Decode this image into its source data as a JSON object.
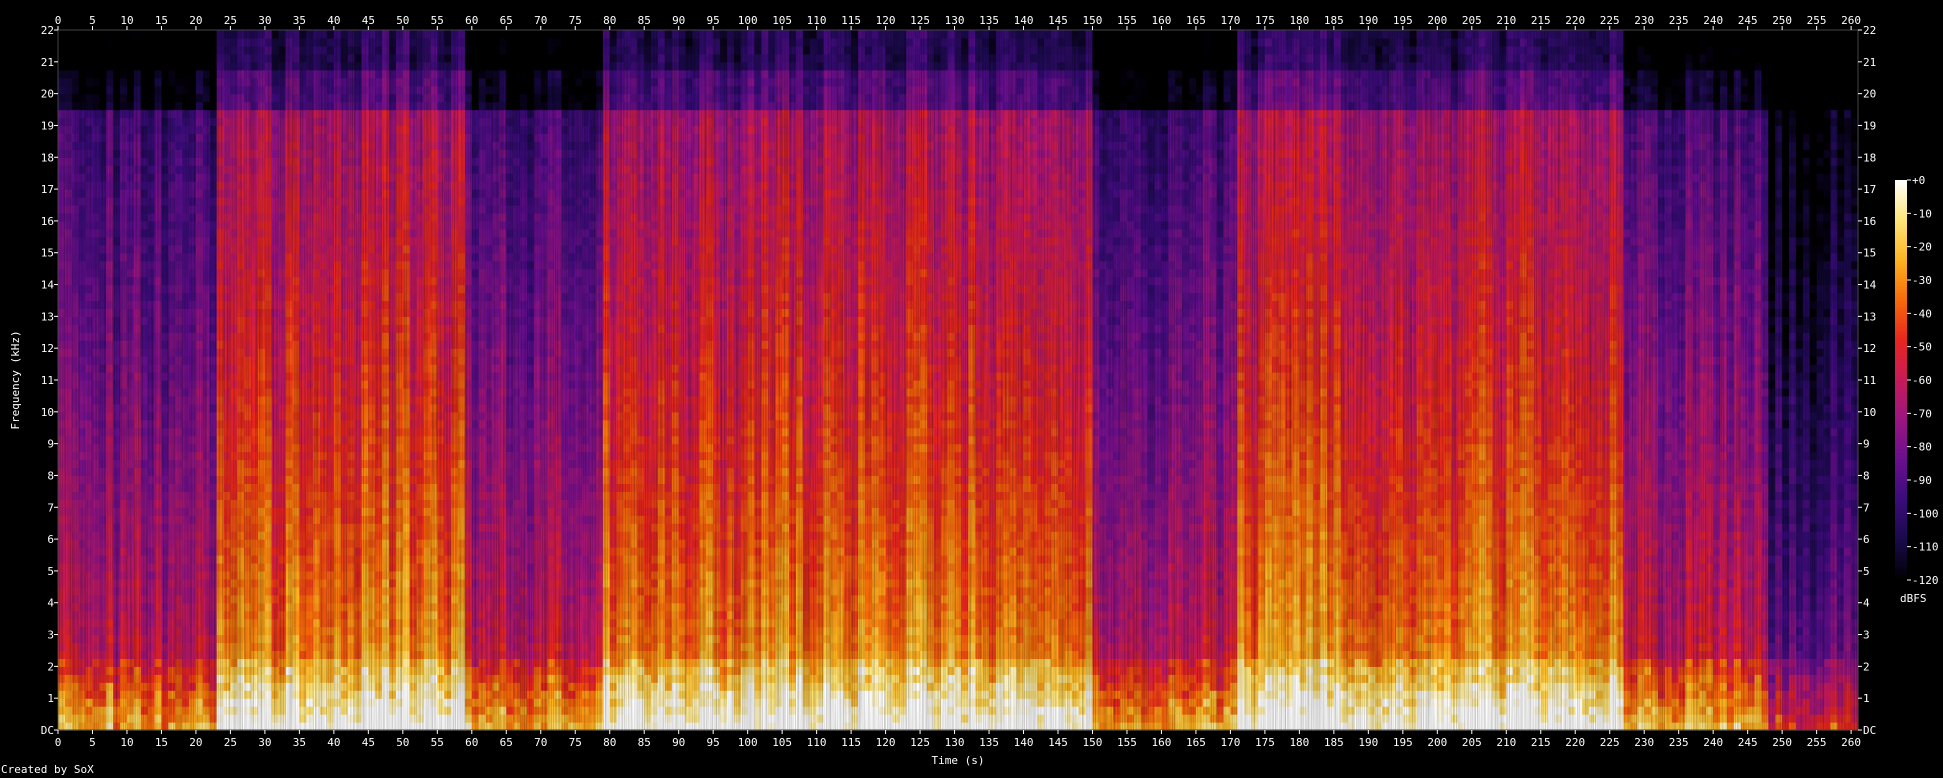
{
  "chart_data": {
    "type": "heatmap",
    "title": "",
    "xlabel": "Time (s)",
    "ylabel": "Frequency (kHz)",
    "xlim": [
      0,
      261
    ],
    "ylim": [
      0,
      22
    ],
    "x_ticks": [
      "0",
      "5",
      "10",
      "15",
      "20",
      "25",
      "30",
      "35",
      "40",
      "45",
      "50",
      "55",
      "60",
      "65",
      "70",
      "75",
      "80",
      "85",
      "90",
      "95",
      "100",
      "105",
      "110",
      "115",
      "120",
      "125",
      "130",
      "135",
      "140",
      "145",
      "150",
      "155",
      "160",
      "165",
      "170",
      "175",
      "180",
      "185",
      "190",
      "195",
      "200",
      "205",
      "210",
      "215",
      "220",
      "225",
      "230",
      "235",
      "240",
      "245",
      "250",
      "255",
      "260"
    ],
    "y_ticks": [
      "DC",
      "1",
      "2",
      "3",
      "4",
      "5",
      "6",
      "7",
      "8",
      "9",
      "10",
      "11",
      "12",
      "13",
      "14",
      "15",
      "16",
      "17",
      "18",
      "19",
      "20",
      "21",
      "22"
    ],
    "colorbar": {
      "label": "dBFS",
      "ticks": [
        "+0",
        "-10",
        "-20",
        "-30",
        "-40",
        "-50",
        "-60",
        "-70",
        "-80",
        "-90",
        "-100",
        "-110",
        "-120"
      ],
      "range": [
        -120,
        0
      ]
    },
    "colormap": [
      "#000000",
      "#1a0a4a",
      "#3a0c7a",
      "#6a0f8e",
      "#9a1580",
      "#c81a5a",
      "#e8261e",
      "#f86a0a",
      "#fcb420",
      "#ffe678",
      "#ffffff"
    ],
    "energy_profile": [
      {
        "t0": 0,
        "t1": 4,
        "level": 0.62
      },
      {
        "t0": 4,
        "t1": 23,
        "level": 0.6
      },
      {
        "t0": 23,
        "t1": 40,
        "level": 0.82
      },
      {
        "t0": 40,
        "t1": 59,
        "level": 0.86
      },
      {
        "t0": 59,
        "t1": 79,
        "level": 0.6
      },
      {
        "t0": 79,
        "t1": 150,
        "level": 0.84
      },
      {
        "t0": 150,
        "t1": 171,
        "level": 0.6
      },
      {
        "t0": 171,
        "t1": 227,
        "level": 0.84
      },
      {
        "t0": 227,
        "t1": 248,
        "level": 0.62
      },
      {
        "t0": 248,
        "t1": 261,
        "level": 0.38
      }
    ]
  },
  "credit": "Created by SoX"
}
